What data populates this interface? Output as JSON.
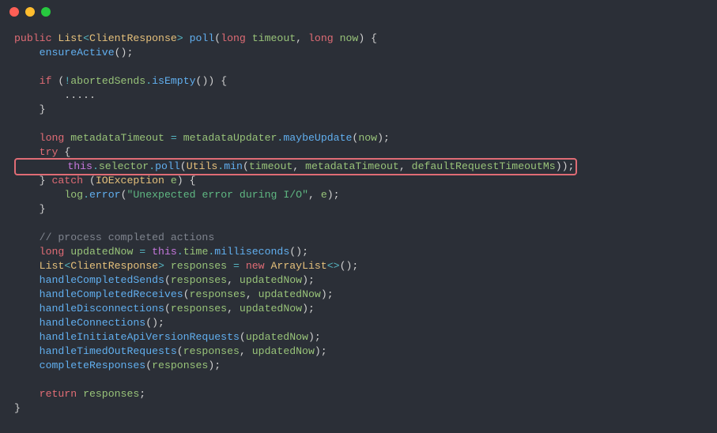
{
  "t": {
    "l1_public": "public ",
    "l1_List": "List",
    "l1_lt": "<",
    "l1_CR": "ClientResponse",
    "l1_gt": "> ",
    "l1_poll": "poll",
    "l1_op": "(",
    "l1_long1": "long ",
    "l1_timeout": "timeout",
    "l1_c1": ", ",
    "l1_long2": "long ",
    "l1_now": "now",
    "l1_cp": ") {",
    "l2": "    ",
    "l2_fn": "ensureActive",
    "l2_p": "();",
    "l3": "",
    "l4": "    ",
    "l4_if": "if ",
    "l4_op": "(",
    "l4_bang": "!",
    "l4_as": "abortedSends",
    "l4_dot": ".",
    "l4_ie": "isEmpty",
    "l4_cp": "()) {",
    "l5": "        .....",
    "l6": "    }",
    "l7": "",
    "l8": "    ",
    "l8_long": "long ",
    "l8_mt": "metadataTimeout",
    " l8_eq": " = ",
    "l8_mu": "metadataUpdater",
    "l8_dot": ".",
    "l8_me": "maybeUpdate",
    "l8_op": "(",
    "l8_now": "now",
    "l8_cp": ");",
    "l9": "    ",
    "l9_try": "try ",
    "l9_ob": "{",
    "l10a": "        ",
    "l10_this": "this",
    "l10_dot1": ".",
    "l10_sel": "selector",
    "l10_dot2": ".",
    "l10_poll": "poll",
    "l10_op": "(",
    "l10_Utils": "Utils",
    "l10_dot3": ".",
    "l10_min": "min",
    "l10_op2": "(",
    "l10_to": "timeout",
    "l10_c1": ", ",
    "l10_mt": "metadataTimeout",
    "l10_c2": ", ",
    "l10_drt": "defaultRequestTimeoutMs",
    "l10_cp": "));",
    "l11": "    } ",
    "l11_catch": "catch ",
    "l11_op": "(",
    "l11_IOE": "IOException ",
    "l11_e": "e",
    "l11_cp": ") {",
    "l12": "        ",
    "l12_log": "log",
    "l12_dot": ".",
    "l12_err": "error",
    "l12_op": "(",
    "l12_str": "\"Unexpected error during I/O\"",
    "l12_c": ", ",
    "l12_e": "e",
    "l12_cp": ");",
    "l13": "    }",
    "l14": "",
    "l15": "    ",
    "l15_c": "// process completed actions",
    "l16": "    ",
    "l16_long": "long ",
    "l16_un": "updatedNow",
    " l16_eq": " = ",
    "l16_this": "this",
    "l16_dot1": ".",
    "l16_time": "time",
    "l16_dot2": ".",
    "l16_ms": "milliseconds",
    "l16_p": "();",
    "l17": "    ",
    "l17_List": "List",
    "l17_lt": "<",
    "l17_CR": "ClientResponse",
    "l17_gt": "> ",
    "l17_resp": "responses",
    " l17_eq": " = ",
    "l17_new": "new ",
    "l17_AL": "ArrayList",
    "l17_dia": "<>",
    "l17_p": "();",
    "l18": "    ",
    "l18_fn": "handleCompletedSends",
    "l18_op": "(",
    "l18_r": "responses",
    "l18_c": ", ",
    "l18_un": "updatedNow",
    "l18_cp": ");",
    "l19": "    ",
    "l19_fn": "handleCompletedReceives",
    "l19_op": "(",
    "l19_r": "responses",
    "l19_c": ", ",
    "l19_un": "updatedNow",
    "l19_cp": ");",
    "l20": "    ",
    "l20_fn": "handleDisconnections",
    "l20_op": "(",
    "l20_r": "responses",
    "l20_c": ", ",
    "l20_un": "updatedNow",
    "l20_cp": ");",
    "l21": "    ",
    "l21_fn": "handleConnections",
    "l21_p": "();",
    "l22": "    ",
    "l22_fn": "handleInitiateApiVersionRequests",
    "l22_op": "(",
    "l22_un": "updatedNow",
    "l22_cp": ");",
    "l23": "    ",
    "l23_fn": "handleTimedOutRequests",
    "l23_op": "(",
    "l23_r": "responses",
    "l23_c": ", ",
    "l23_un": "updatedNow",
    "l23_cp": ");",
    "l24": "    ",
    "l24_fn": "completeResponses",
    "l24_op": "(",
    "l24_r": "responses",
    "l24_cp": ");",
    "l25": "",
    "l26": "    ",
    "l26_ret": "return ",
    "l26_r": "responses",
    "l26_sc": ";",
    "l27": "}"
  }
}
